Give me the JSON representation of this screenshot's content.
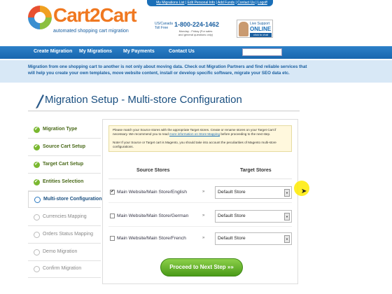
{
  "header": {
    "logo_text": "Cart2Cart",
    "tagline": "automated shopping cart migration",
    "top_links": [
      "My Migrations List",
      "Edit Personal Info",
      "Add Funds",
      "Contact Us",
      "Logoff"
    ],
    "region": "US/Canada Toll Free",
    "phone": "1-800-224-1462",
    "phone_note": "Monday - Friday (For sales and general questions only)",
    "live_support": {
      "line1": "Live Support",
      "line2": "ONLINE",
      "line3": "click to chat"
    }
  },
  "nav": {
    "items": [
      "Create Migration",
      "My Migrations",
      "My Payments",
      "Contact Us"
    ],
    "search_placeholder": ""
  },
  "banner": {
    "text": "Migration from one shopping cart to another is not only about moving data. Check out Migration Partners and find reliable services that will help you create your own templates, move website content, install or develop specific software, migrate your SEO data etc."
  },
  "page": {
    "title": "Migration Setup - Multi-store Configuration"
  },
  "steps": [
    {
      "label": "Migration Type",
      "state": "done"
    },
    {
      "label": "Source Cart Setup",
      "state": "done"
    },
    {
      "label": "Target Cart Setup",
      "state": "done"
    },
    {
      "label": "Entities Selection",
      "state": "done"
    },
    {
      "label": "Multi-store Configuration",
      "state": "active"
    },
    {
      "label": "Currencies Mapping",
      "state": "pending"
    },
    {
      "label": "Orders Status Mapping",
      "state": "pending"
    },
    {
      "label": "Demo Migration",
      "state": "pending"
    },
    {
      "label": "Confirm Migration",
      "state": "pending"
    }
  ],
  "info": {
    "text1_a": "Please match your Source stores with the appropriate Target stores. Create or rename stores on your Target Cart if necessary. We recommend you to read ",
    "text1_link": "more information on Store Mapping",
    "text1_b": " before proceeding to the next step.",
    "text2": "Note! If your Source or Target cart is Magento, you should take into account the peculiarities of Magento multi-store configurations."
  },
  "table": {
    "col_source": "Source Stores",
    "col_target": "Target Stores",
    "rows": [
      {
        "source": "Main Website/Main Store/English",
        "checked": true,
        "arrow": "»",
        "target": "Default Store"
      },
      {
        "source": "Main Website/Main Store/German",
        "checked": false,
        "arrow": "»",
        "target": "Default Store"
      },
      {
        "source": "Main Website/Main Store/French",
        "checked": false,
        "arrow": "»",
        "target": "Default Store"
      }
    ]
  },
  "proceed_label": "Proceed to Next Step »»",
  "colors": {
    "brand_orange": "#f07820",
    "brand_blue": "#1a6fb8",
    "success_green": "#7ab830"
  }
}
